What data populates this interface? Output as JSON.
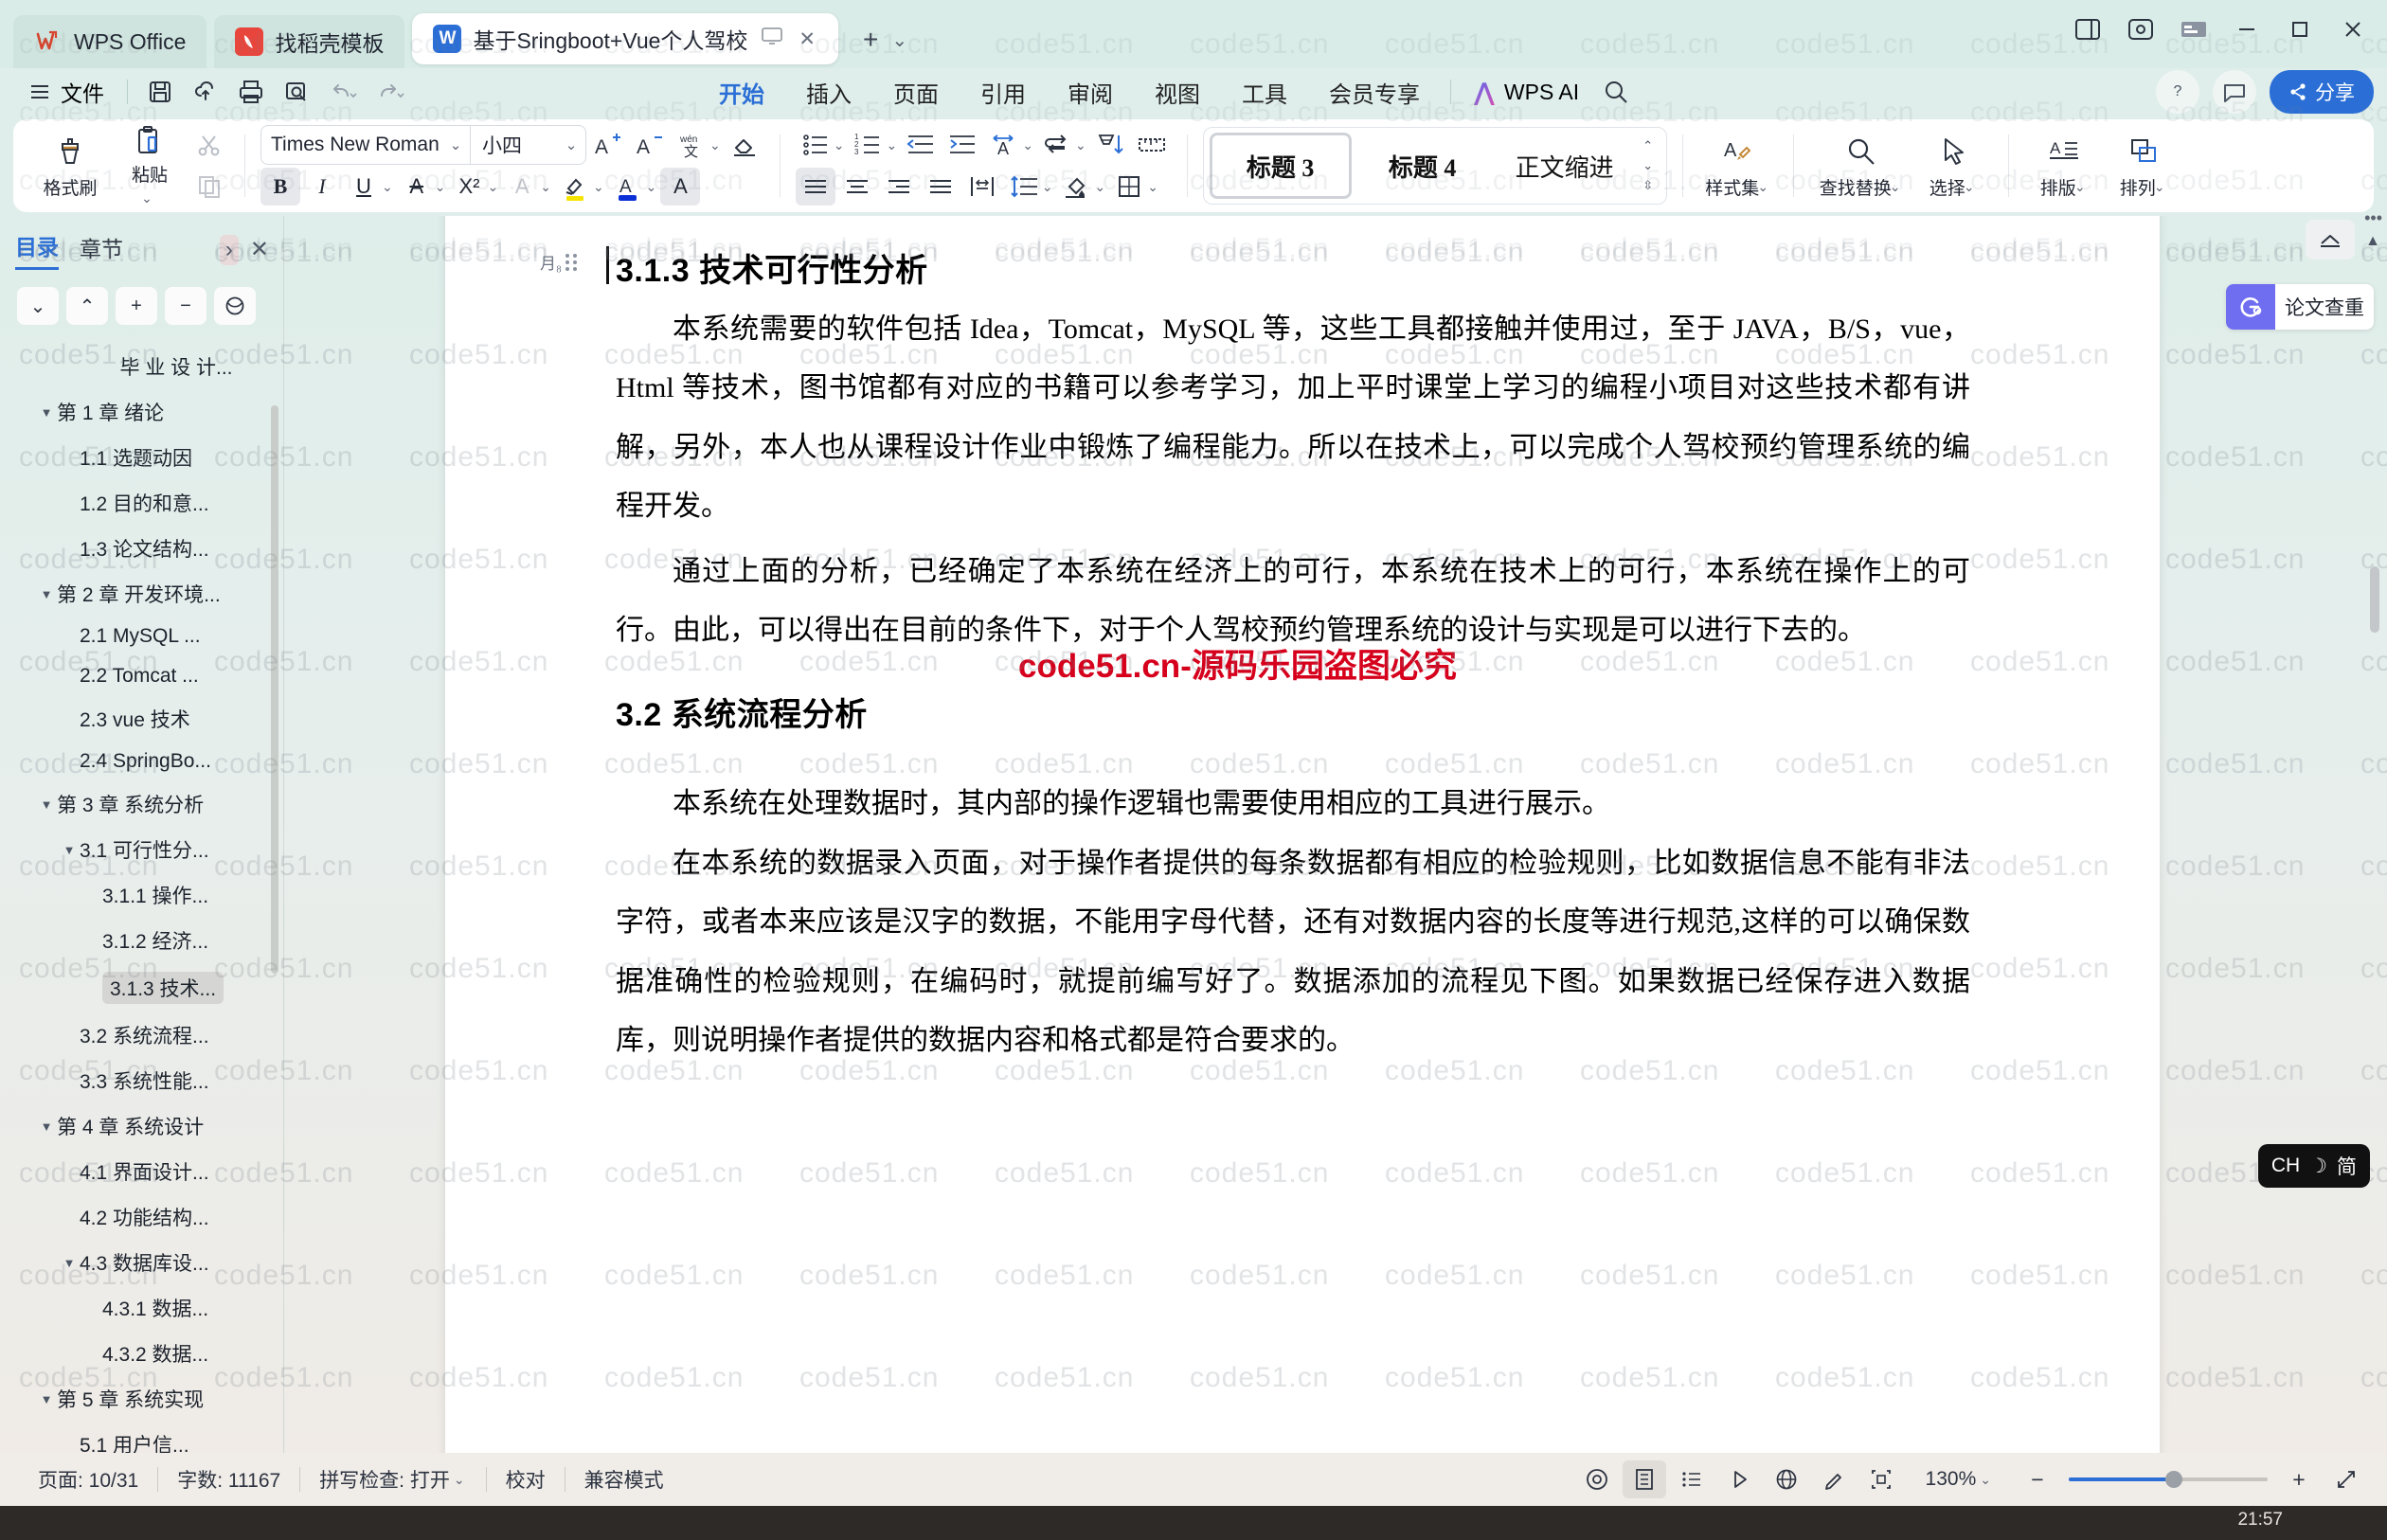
{
  "window": {
    "tabs": [
      {
        "label": "WPS Office",
        "icon": "wps-logo-icon",
        "active": false
      },
      {
        "label": "找稻壳模板",
        "icon": "docer-icon",
        "active": false
      },
      {
        "label": "基于Sringboot+Vue个人驾校",
        "icon": "word-doc-icon",
        "active": true
      }
    ],
    "new_tab": "+",
    "controls": {
      "minimize": "—",
      "maximize": "▢",
      "close": "✕"
    }
  },
  "quickaccess": {
    "file_menu": "文件",
    "items": [
      "save-icon",
      "cloud-sync-icon",
      "print-icon",
      "print-preview-icon",
      "undo-icon",
      "redo-icon",
      "customize-icon"
    ]
  },
  "ribbon": {
    "tabs": [
      {
        "label": "开始",
        "active": true
      },
      {
        "label": "插入",
        "active": false
      },
      {
        "label": "页面",
        "active": false
      },
      {
        "label": "引用",
        "active": false
      },
      {
        "label": "审阅",
        "active": false
      },
      {
        "label": "视图",
        "active": false
      },
      {
        "label": "工具",
        "active": false
      },
      {
        "label": "会员专享",
        "active": false
      }
    ],
    "ai_label": "WPS AI",
    "search_icon": "search-icon",
    "right": {
      "help_label": "?",
      "comment_icon": "comment-icon",
      "share_label": "分享"
    }
  },
  "toolbar": {
    "format_painter": "格式刷",
    "paste": "粘贴",
    "cut_icon": "scissors-icon",
    "copy_icon": "copy-icon",
    "font_name": "Times New Roman",
    "font_size": "小四",
    "grow_font": "A⁺",
    "shrink_font": "A⁻",
    "pinyin": "wén",
    "clear_format_icon": "eraser-icon",
    "bold": "B",
    "italic": "I",
    "underline": "U",
    "strikethrough": "A",
    "superscript": "X²",
    "text_effects": "A",
    "highlight": "highlight-icon",
    "font_color": "font-color-icon",
    "char_shading": "A",
    "bullets_icon": "bullet-list-icon",
    "numbering_icon": "numbered-list-icon",
    "decrease_indent_icon": "decrease-indent-icon",
    "increase_indent_icon": "increase-indent-icon",
    "asian_layout_icon": "asian-layout-icon",
    "show_marks_icon": "paragraph-marks-icon",
    "sort_icon": "sort-icon",
    "ruler_icon": "ruler-icon",
    "align_left_icon": "align-left-icon",
    "align_center_icon": "align-center-icon",
    "align_right_icon": "align-right-icon",
    "align_justify_icon": "align-justify-icon",
    "distribute_icon": "distribute-icon",
    "line_spacing_icon": "line-spacing-icon",
    "shading_icon": "shading-icon",
    "borders_icon": "borders-icon",
    "styles": [
      {
        "label": "标题 3",
        "selected": true
      },
      {
        "label": "标题 4",
        "selected": false
      },
      {
        "label": "正文缩进",
        "selected": false
      }
    ],
    "style_set": "样式集",
    "find_replace": "查找替换",
    "select": "选择",
    "typeset": "排版",
    "arrange": "排列"
  },
  "navpanel": {
    "tabs": [
      {
        "label": "目录",
        "active": true
      },
      {
        "label": "章节",
        "active": false
      }
    ],
    "expand_icon": "chevron-right-icon",
    "close_icon": "close-icon",
    "buttons": [
      "collapse-down-icon",
      "collapse-up-icon",
      "plus-icon",
      "minus-icon",
      "sync-icon"
    ],
    "toc": [
      {
        "label": "毕 业 设 计...",
        "level": 0,
        "arrow": "",
        "selected": false,
        "center": true
      },
      {
        "label": "第 1 章 绪论",
        "level": 1,
        "arrow": "▼",
        "selected": false
      },
      {
        "label": "1.1 选题动因",
        "level": 2,
        "arrow": "",
        "selected": false
      },
      {
        "label": "1.2 目的和意...",
        "level": 2,
        "arrow": "",
        "selected": false
      },
      {
        "label": "1.3 论文结构...",
        "level": 2,
        "arrow": "",
        "selected": false
      },
      {
        "label": "第 2 章 开发环境...",
        "level": 1,
        "arrow": "▼",
        "selected": false
      },
      {
        "label": "2.1 MySQL ...",
        "level": 2,
        "arrow": "",
        "selected": false
      },
      {
        "label": "2.2 Tomcat  ...",
        "level": 2,
        "arrow": "",
        "selected": false
      },
      {
        "label": "2.3 vue 技术",
        "level": 2,
        "arrow": "",
        "selected": false
      },
      {
        "label": "2.4 SpringBo...",
        "level": 2,
        "arrow": "",
        "selected": false
      },
      {
        "label": "第 3 章 系统分析",
        "level": 1,
        "arrow": "▼",
        "selected": false
      },
      {
        "label": "3.1 可行性分...",
        "level": 2,
        "arrow": "▼",
        "selected": false
      },
      {
        "label": "3.1.1 操作...",
        "level": 3,
        "arrow": "",
        "selected": false
      },
      {
        "label": "3.1.2 经济...",
        "level": 3,
        "arrow": "",
        "selected": false
      },
      {
        "label": "3.1.3 技术...",
        "level": 3,
        "arrow": "",
        "selected": true
      },
      {
        "label": "3.2 系统流程...",
        "level": 2,
        "arrow": "",
        "selected": false
      },
      {
        "label": "3.3 系统性能...",
        "level": 2,
        "arrow": "",
        "selected": false
      },
      {
        "label": "第 4 章 系统设计",
        "level": 1,
        "arrow": "▼",
        "selected": false
      },
      {
        "label": "4.1 界面设计...",
        "level": 2,
        "arrow": "",
        "selected": false
      },
      {
        "label": "4.2 功能结构...",
        "level": 2,
        "arrow": "",
        "selected": false
      },
      {
        "label": "4.3 数据库设...",
        "level": 2,
        "arrow": "▼",
        "selected": false
      },
      {
        "label": "4.3.1  数据...",
        "level": 3,
        "arrow": "",
        "selected": false
      },
      {
        "label": "4.3.2  数据...",
        "level": 3,
        "arrow": "",
        "selected": false
      },
      {
        "label": "第 5 章 系统实现",
        "level": 1,
        "arrow": "▼",
        "selected": false
      },
      {
        "label": "5.1 用户信...",
        "level": 2,
        "arrow": "",
        "selected": false
      }
    ]
  },
  "document": {
    "heading1": "3.1.3 技术可行性分析",
    "para1": "本系统需要的软件包括 Idea，Tomcat，MySQL 等，这些工具都接触并使用过，至于 JAVA，B/S，vue，Html 等技术，图书馆都有对应的书籍可以参考学习，加上平时课堂上学习的编程小项目对这些技术都有讲解，另外，本人也从课程设计作业中锻炼了编程能力。所以在技术上，可以完成个人驾校预约管理系统的编程开发。",
    "para2": "通过上面的分析，已经确定了本系统在经济上的可行，本系统在技术上的可行，本系统在操作上的可行。由此，可以得出在目前的条件下，对于个人驾校预约管理系统的设计与实现是可以进行下去的。",
    "heading2": "3.2 系统流程分析",
    "para3": "本系统在处理数据时，其内部的操作逻辑也需要使用相应的工具进行展示。",
    "para4": "在本系统的数据录入页面，对于操作者提供的每条数据都有相应的检验规则，比如数据信息不能有非法字符，或者本来应该是汉字的数据，不能用字母代替，还有对数据内容的长度等进行规范,这样的可以确保数据准确性的检验规则，在编码时，就提前编写好了。数据添加的流程见下图。如果数据已经保存进入数据库，则说明操作者提供的数据内容和格式都是符合要求的。",
    "para_handle_label": "月₈",
    "watermark_text": "code51.cn",
    "red_stamp": "code51.cn-源码乐园盗图必究"
  },
  "rightrail": {
    "collapse_ribbon_icon": "collapse-ribbon-icon",
    "plagiarism_check": "论文查重",
    "plagiarism_icon": "plagiarism-check-icon",
    "ime": {
      "lang": "CH",
      "mode_icon": "moon-icon",
      "script": "简"
    }
  },
  "statusbar": {
    "page": "页面: 10/31",
    "words": "字数: 11167",
    "spellcheck": "拼写检查: 打开",
    "proofread": "校对",
    "compat": "兼容模式",
    "view_icons": [
      "focus-mode-icon",
      "page-view-icon",
      "outline-view-icon",
      "reading-view-icon",
      "web-view-icon",
      "markup-icon",
      "fullscreen-icon"
    ],
    "zoom": "130%",
    "zoom_out": "−",
    "zoom_in": "+",
    "expand_icon": "expand-icon"
  },
  "taskbar": {
    "clock": "21:57"
  },
  "colors": {
    "accent": "#2b6fd6",
    "window_bg": "#dfeeea",
    "toolbar_bg": "#ffffff",
    "stamp_red": "#d6001c",
    "taskbar": "#2e2a27"
  }
}
